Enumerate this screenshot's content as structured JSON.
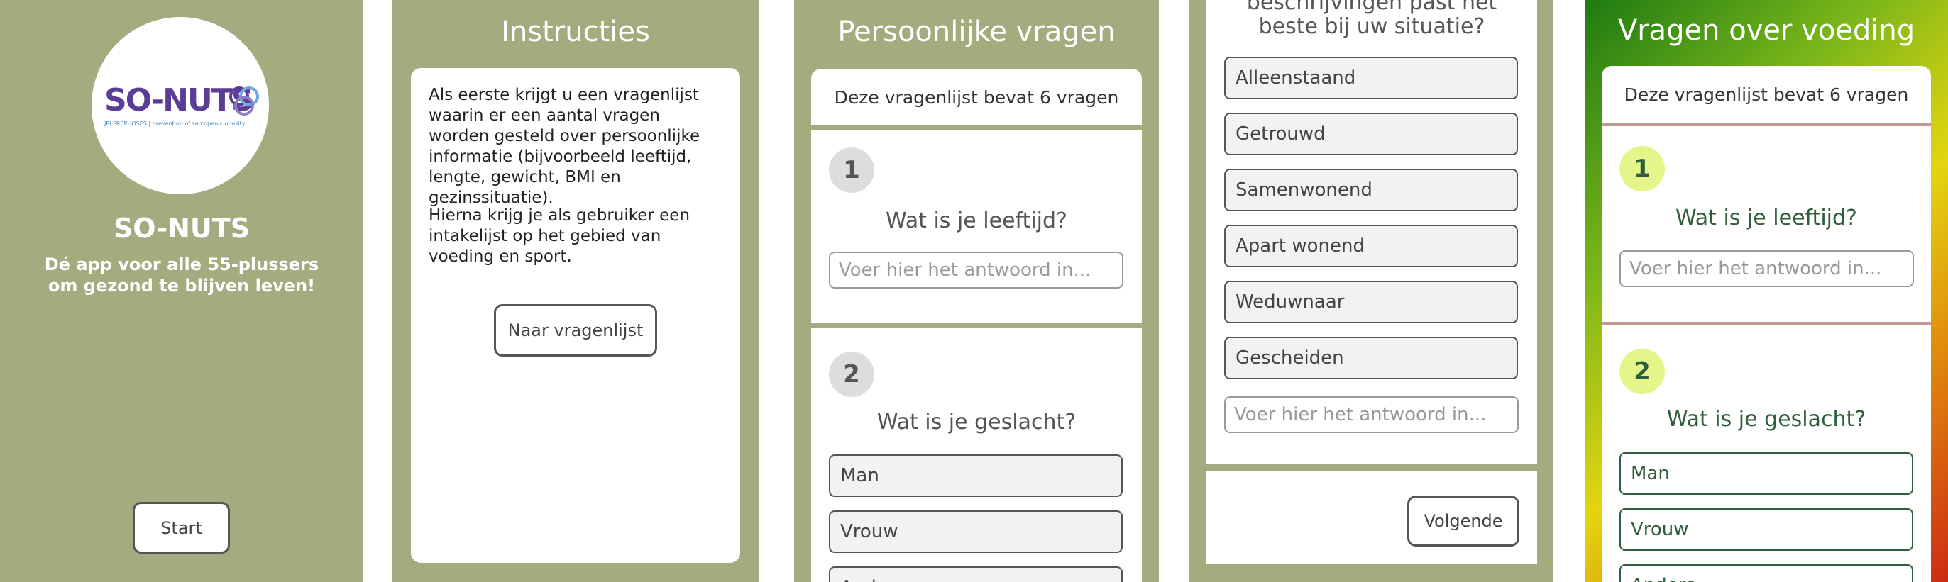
{
  "screen1": {
    "logo_text": "SO-NUTS",
    "logo_subtext": "JPI PREPHOSES | prevention of sarcopenic obesity",
    "app_name": "SO-NUTS",
    "tagline": "Dé app voor alle 55-plussers om gezond te blijven leven!",
    "start_label": "Start"
  },
  "screen2": {
    "title": "Instructies",
    "paragraph1": "Als eerste krijgt u een vragenlijst waarin er een aantal vragen worden gesteld over persoonlijke informatie (bijvoorbeeld leeftijd, lengte, gewicht, BMI en gezinssituatie).",
    "paragraph2": "Hierna krijg je als gebruiker een intakelijst op het gebied van voeding en sport.",
    "button_label": "Naar vragenlijst"
  },
  "screen3": {
    "title": "Persoonlijke vragen",
    "count_text": "Deze vragenlijst bevat 6 vragen",
    "q1_number": "1",
    "q1_text": "Wat is je leeftijd?",
    "q1_placeholder": "Voer hier het antwoord in...",
    "q2_number": "2",
    "q2_text": "Wat is je geslacht?",
    "q2_options": [
      "Man",
      "Vrouw",
      "Anders"
    ]
  },
  "screen4": {
    "question_partial_line1": "beschrijvingen past het",
    "question_partial_line2": "beste bij uw situatie?",
    "options": [
      "Alleenstaand",
      "Getrouwd",
      "Samenwonend",
      "Apart wonend",
      "Weduwnaar",
      "Gescheiden"
    ],
    "placeholder": "Voer hier het antwoord in...",
    "next_label": "Volgende"
  },
  "screen5": {
    "title": "Vragen over voeding",
    "count_text": "Deze vragenlijst bevat 6 vragen",
    "q1_number": "1",
    "q1_text": "Wat is je leeftijd?",
    "q1_placeholder": "Voer hier het antwoord in...",
    "q2_number": "2",
    "q2_text": "Wat is je geslacht?",
    "q2_options": [
      "Man",
      "Vrouw",
      "Anders"
    ]
  },
  "colors": {
    "olive": "#a3ac7e",
    "dark_green_text": "#2e5e3a",
    "lime_circle": "#e6f58a",
    "divider_rose": "#c49a8f",
    "logo_purple": "#5b3c96"
  }
}
